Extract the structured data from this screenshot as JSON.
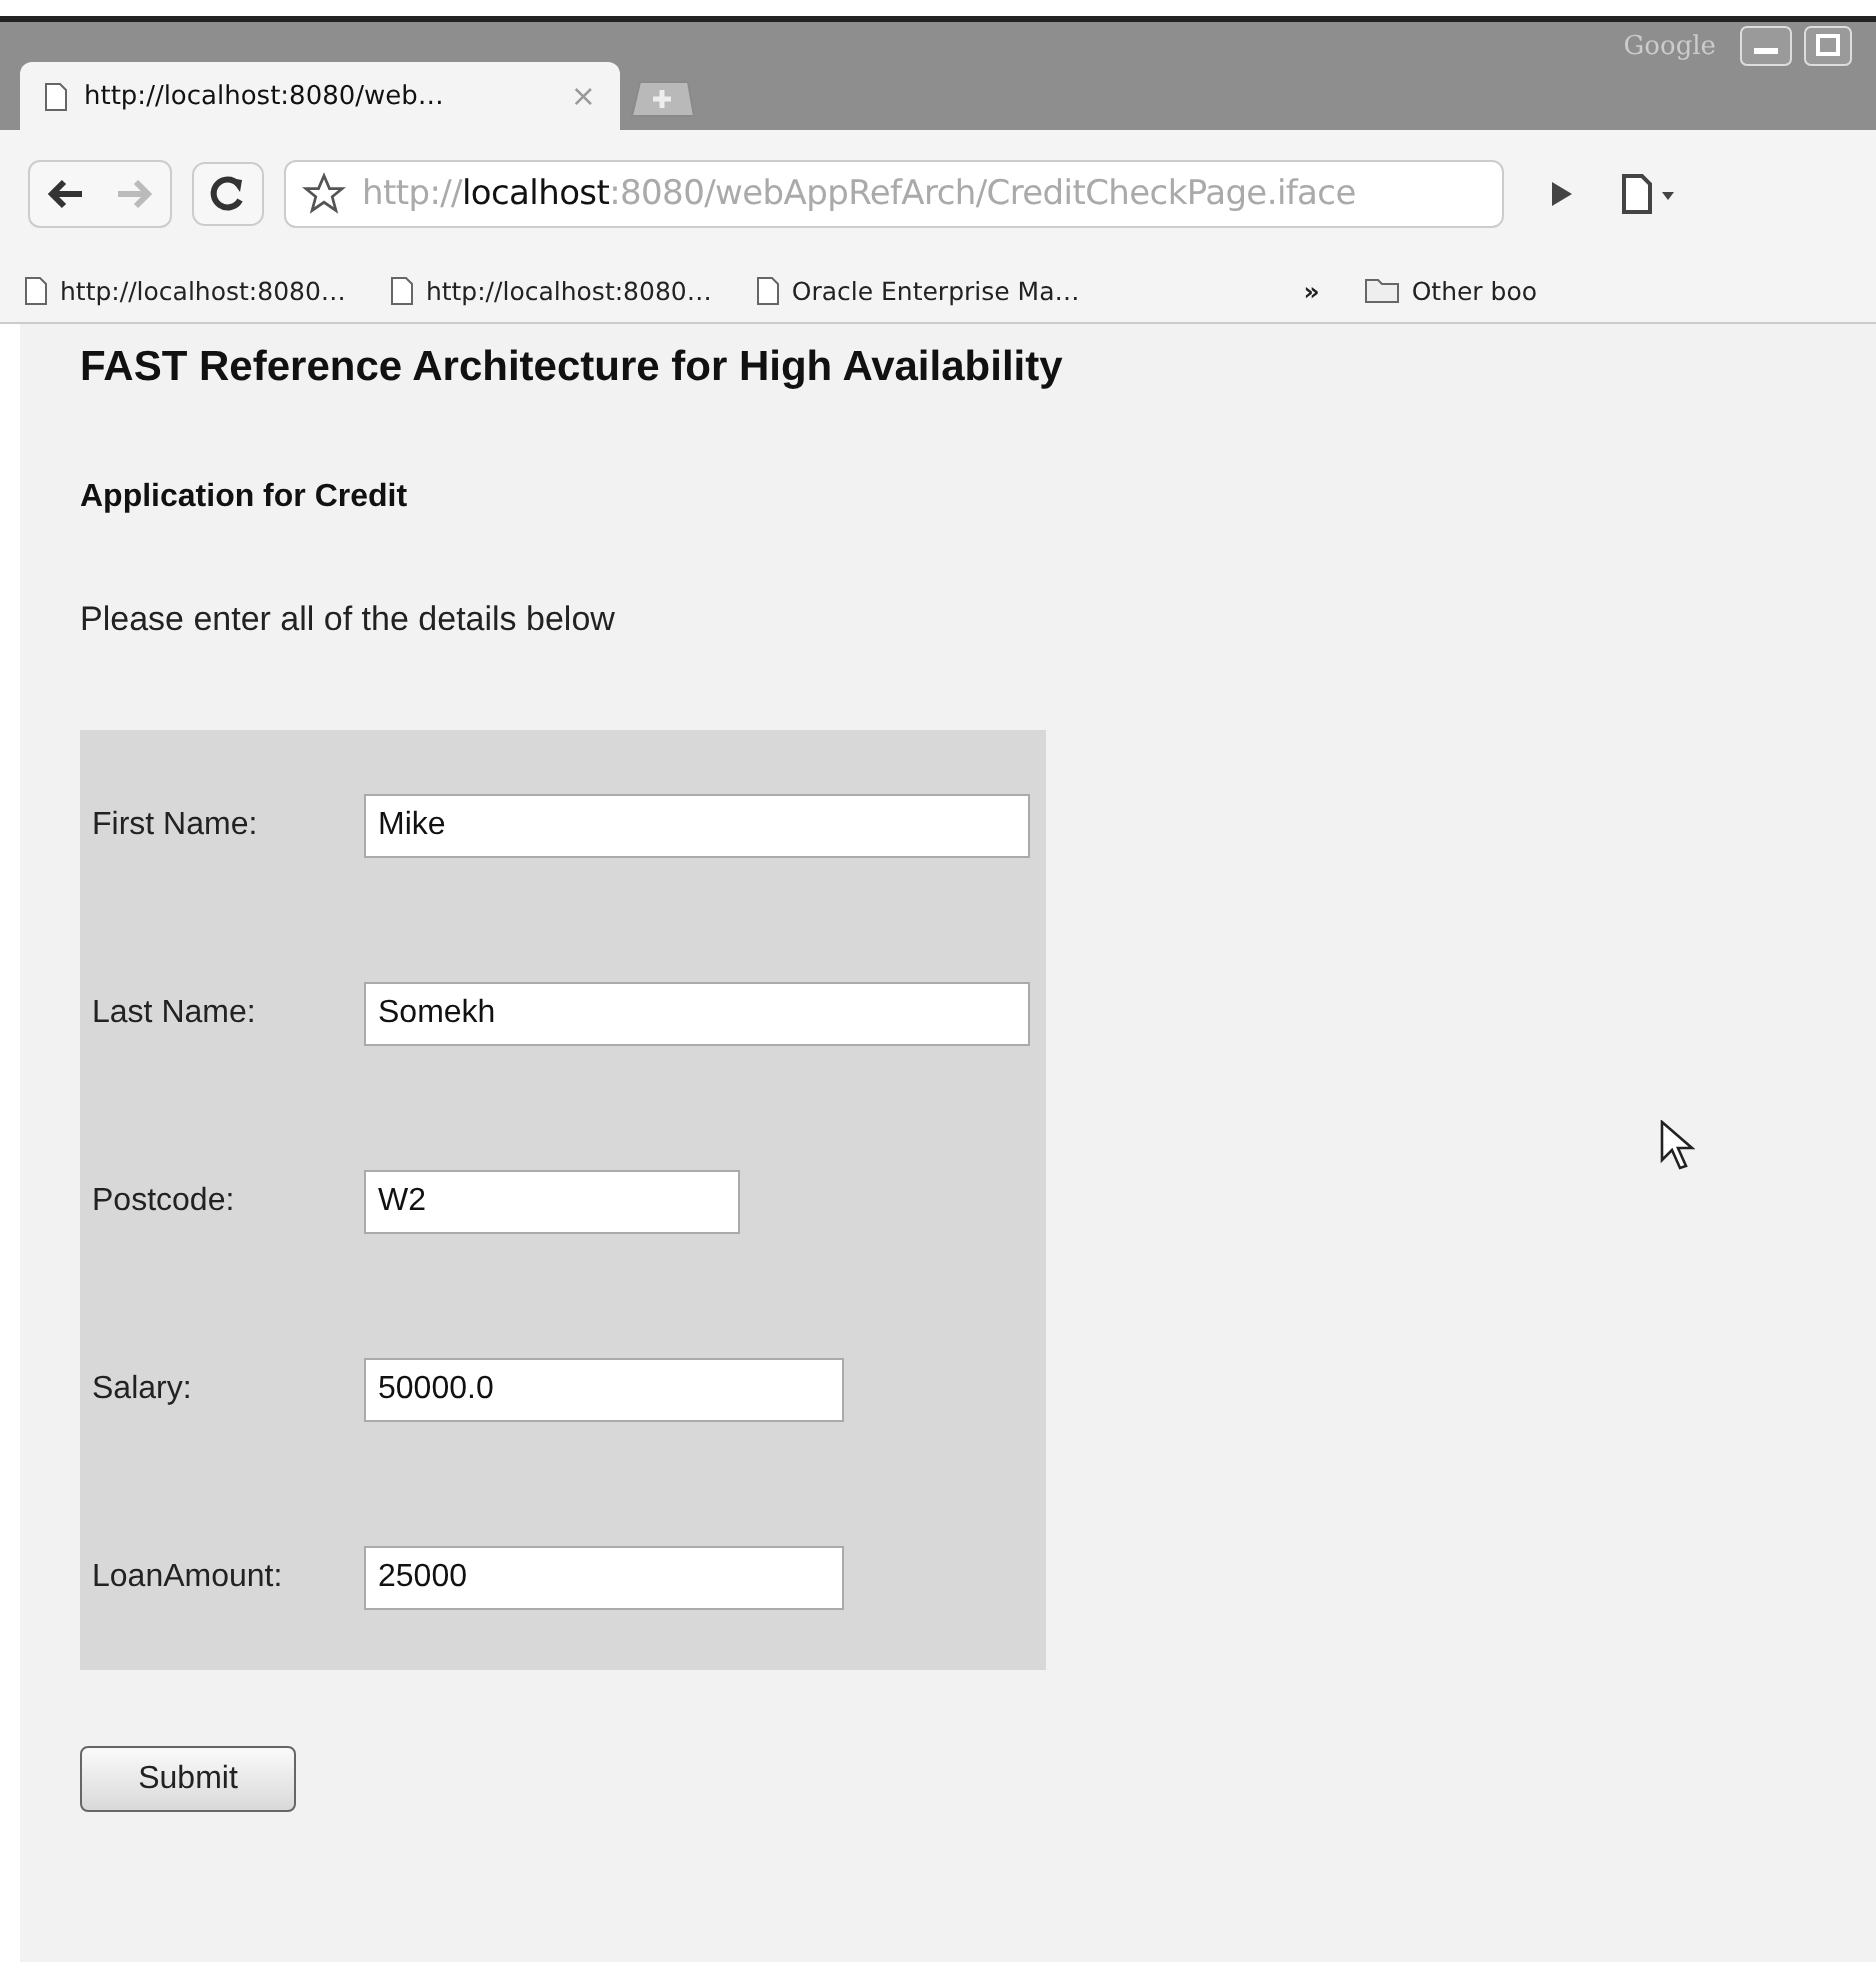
{
  "window": {
    "brand": "Google"
  },
  "tabs": [
    {
      "title": "http://localhost:8080/web…",
      "close": "×",
      "selected": true
    }
  ],
  "address_bar": {
    "scheme": "http://",
    "host": "localhost",
    "rest": ":8080/webAppRefArch/CreditCheckPage.iface"
  },
  "toolbar": {
    "back_disabled": false,
    "forward_disabled": true
  },
  "bookmarks": [
    {
      "label": "http://localhost:8080…"
    },
    {
      "label": "http://localhost:8080…"
    },
    {
      "label": "Oracle Enterprise Ma…"
    }
  ],
  "bookmarks_overflow": "»",
  "other_bookmarks": "Other boo",
  "page": {
    "title": "FAST Reference Architecture for High Availability",
    "subtitle": "Application for Credit",
    "instructions": "Please enter all of the details below",
    "fields": [
      {
        "label": "First Name:",
        "value": "Mike"
      },
      {
        "label": "Last Name:",
        "value": "Somekh"
      },
      {
        "label": "Postcode:",
        "value": "W2"
      },
      {
        "label": "Salary:",
        "value": "50000.0"
      },
      {
        "label": "LoanAmount:",
        "value": "25000"
      }
    ],
    "submit": "Submit"
  }
}
